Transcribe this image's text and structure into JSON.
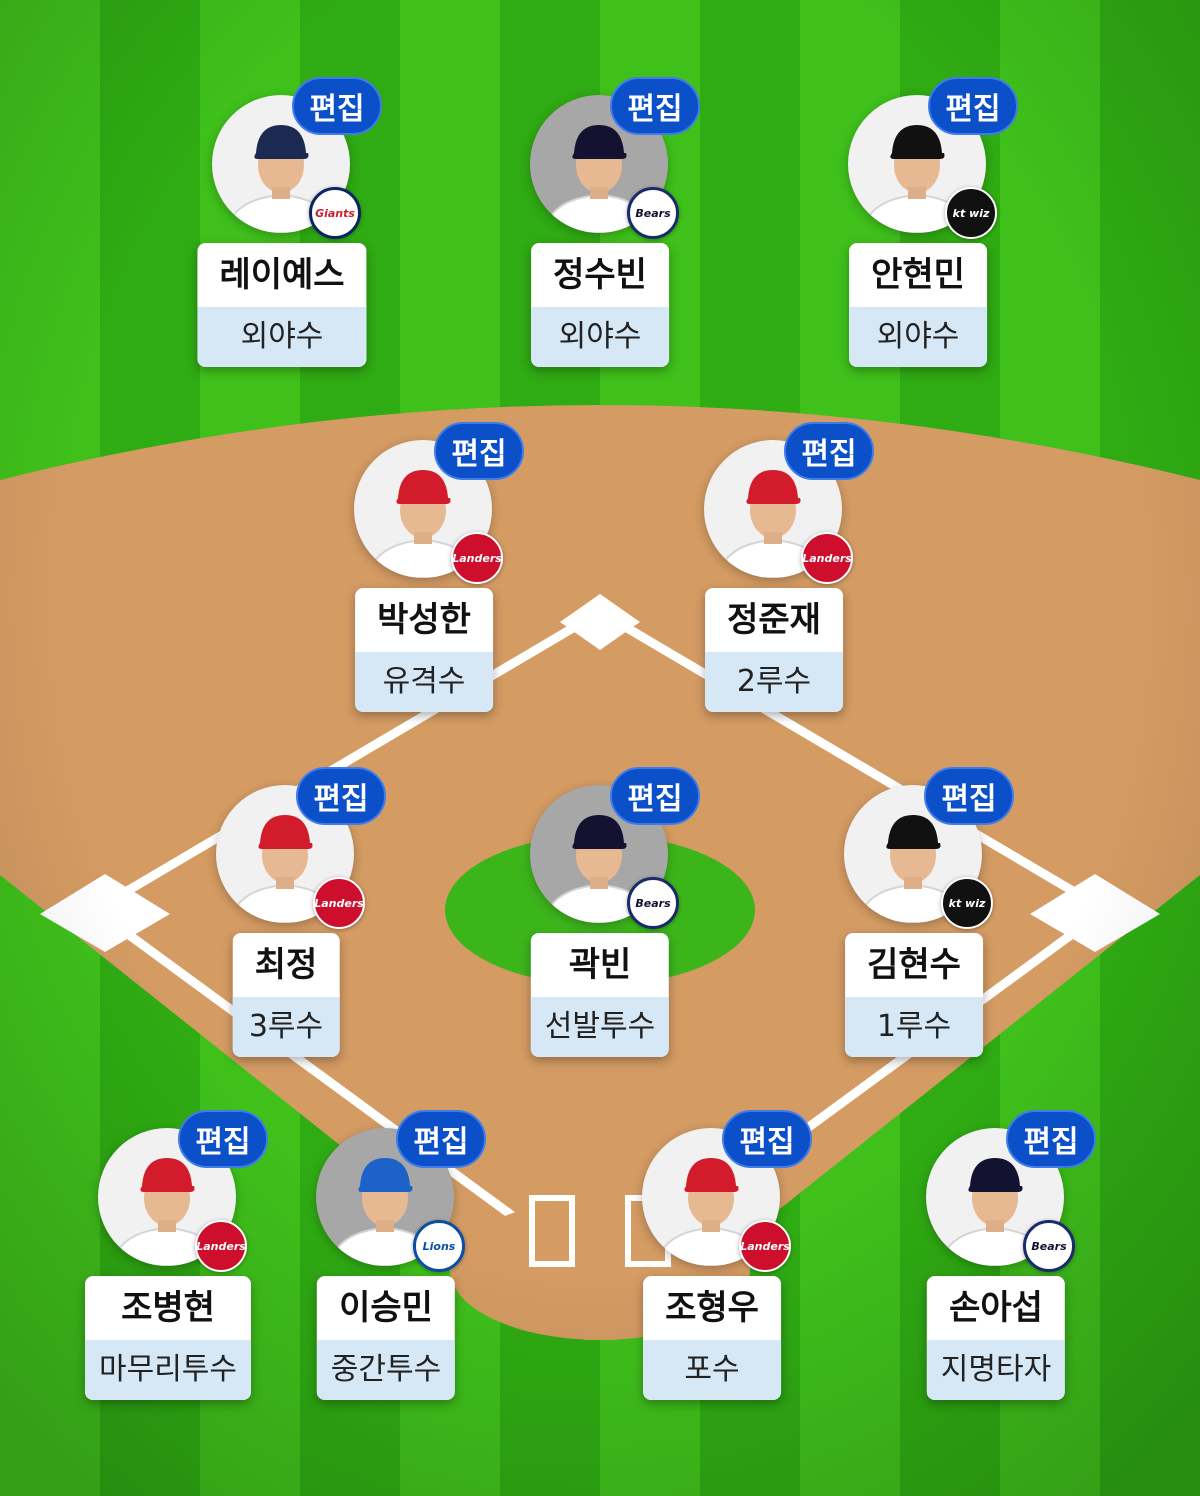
{
  "edit_label": "편집",
  "colors": {
    "grass_light": "#3ec21a",
    "grass_dark": "#2aa50f",
    "dirt": "#d49b63",
    "edit_button": "#0b50c8",
    "position_bg": "#d6e7f6"
  },
  "players": [
    {
      "name": "레이예스",
      "position": "외야수",
      "team": "Giants",
      "team_icon": "giants-logo-icon"
    },
    {
      "name": "정수빈",
      "position": "외야수",
      "team": "Bears",
      "team_icon": "bears-logo-icon"
    },
    {
      "name": "안현민",
      "position": "외야수",
      "team": "kt wiz",
      "team_icon": "ktwiz-logo-icon"
    },
    {
      "name": "박성한",
      "position": "유격수",
      "team": "Landers",
      "team_icon": "landers-logo-icon"
    },
    {
      "name": "정준재",
      "position": "2루수",
      "team": "Landers",
      "team_icon": "landers-logo-icon"
    },
    {
      "name": "최정",
      "position": "3루수",
      "team": "Landers",
      "team_icon": "landers-logo-icon"
    },
    {
      "name": "곽빈",
      "position": "선발투수",
      "team": "Bears",
      "team_icon": "bears-logo-icon"
    },
    {
      "name": "김현수",
      "position": "1루수",
      "team": "kt wiz",
      "team_icon": "ktwiz-logo-icon"
    },
    {
      "name": "조병현",
      "position": "마무리투수",
      "team": "Landers",
      "team_icon": "landers-logo-icon"
    },
    {
      "name": "이승민",
      "position": "중간투수",
      "team": "Lions",
      "team_icon": "lions-logo-icon"
    },
    {
      "name": "조형우",
      "position": "포수",
      "team": "Landers",
      "team_icon": "landers-logo-icon"
    },
    {
      "name": "손아섭",
      "position": "지명타자",
      "team": "Bears",
      "team_icon": "bears-logo-icon"
    }
  ]
}
